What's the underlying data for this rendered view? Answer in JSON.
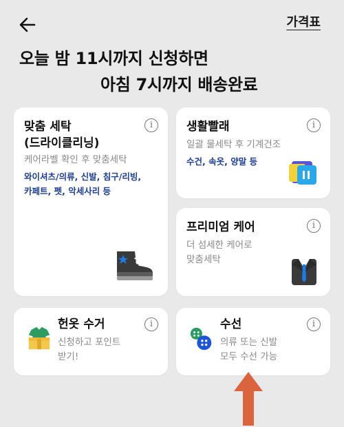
{
  "header": {
    "price_link": "가격표",
    "headline_line1": "오늘 밤 11시까지 신청하면",
    "headline_line2": "아침 7시까지 배송완료"
  },
  "cards": {
    "custom_wash": {
      "title_line1": "맞춤 세탁",
      "title_line2": "(드라이클리닝)",
      "subtitle": "케어라벨 확인 후 맞춤세탁",
      "tags_line1": "와이셔츠/의류, 신발, 침구/리빙,",
      "tags_line2": "카페트, 펫, 악세사리 등"
    },
    "daily_laundry": {
      "title": "생활빨래",
      "subtitle": "일괄 물세탁 후 기계건조",
      "tags": "수건, 속옷, 양말 등"
    },
    "premium_care": {
      "title": "프리미엄 케어",
      "subtitle_line1": "더 섬세한 케어로",
      "subtitle_line2": "맞춤세탁"
    },
    "old_clothes": {
      "title": "헌옷 수거",
      "subtitle_line1": "신청하고 포인트",
      "subtitle_line2": "받기!"
    },
    "repair": {
      "title": "수선",
      "subtitle_line1": "의류 또는 신발",
      "subtitle_line2": "모두 수선 가능"
    }
  },
  "icons": {
    "back": "arrow-left-icon",
    "info": "info-icon",
    "sneaker": "sneaker-icon",
    "laundry": "laundry-bag-icon",
    "suit": "suit-icon",
    "box": "clothes-box-icon",
    "buttons": "buttons-icon",
    "annotation_arrow": "arrow-up-icon"
  },
  "colors": {
    "background": "#e9e9ea",
    "card": "#ffffff",
    "tag_blue": "#1f3f8f",
    "annotation_arrow": "#d9643e"
  },
  "info_glyph": "i"
}
